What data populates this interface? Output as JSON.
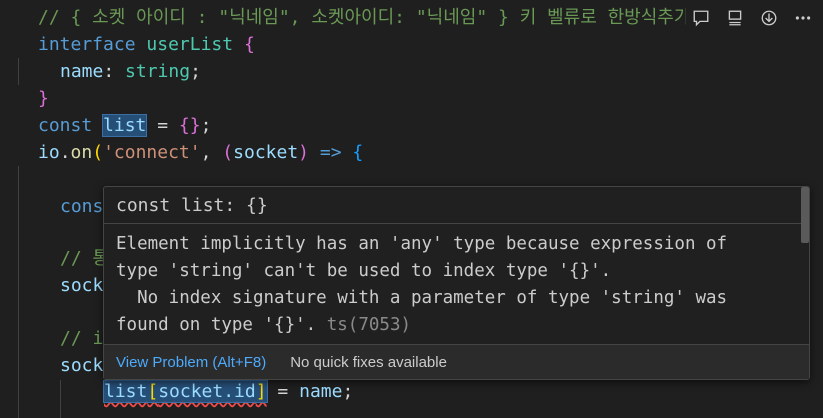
{
  "code": {
    "line1": "// { 소켓 아이디 : \"닉네임\", 소켓아이디: \"닉네임\" } 키 벨류로 한방식추가",
    "line2_kw": "interface",
    "line2_name": "userList",
    "line2_brace": "{",
    "line3_prop": "name",
    "line3_type": "string",
    "line4_brace": "}",
    "line5_kw": "const",
    "line5_var": "list",
    "line5_rest": " = ",
    "line5_braces": "{}",
    "line6_obj": "io",
    "line6_fn": "on",
    "line6_str": "'connect'",
    "line6_param": "socket",
    "line7_partial": "cons",
    "line8_partial": "// 통",
    "line9_partial": "sock",
    "line10_partial": "// i",
    "line11_partial": "sock",
    "line12_var": "list",
    "line12_index": "socket.id",
    "line12_rhs": "name"
  },
  "editor_actions": {
    "icons": [
      "comment-icon",
      "outline-icon",
      "download-icon",
      "more-icon"
    ]
  },
  "hover": {
    "signature": "const list: {}",
    "message_line1": "Element implicitly has an 'any' type because expression of",
    "message_line2": "type 'string' can't be used to index type '{}'.",
    "message_line3": "  No index signature with a parameter of type 'string' was",
    "message_line4": "found on type '{}'.",
    "error_code": "ts(7053)",
    "view_problem": "View Problem (Alt+F8)",
    "no_fixes": "No quick fixes available"
  },
  "colors": {
    "background": "#1f1f1f",
    "keyword": "#569cd6",
    "string": "#ce9178",
    "comment": "#6a9955",
    "link": "#4daafc"
  }
}
